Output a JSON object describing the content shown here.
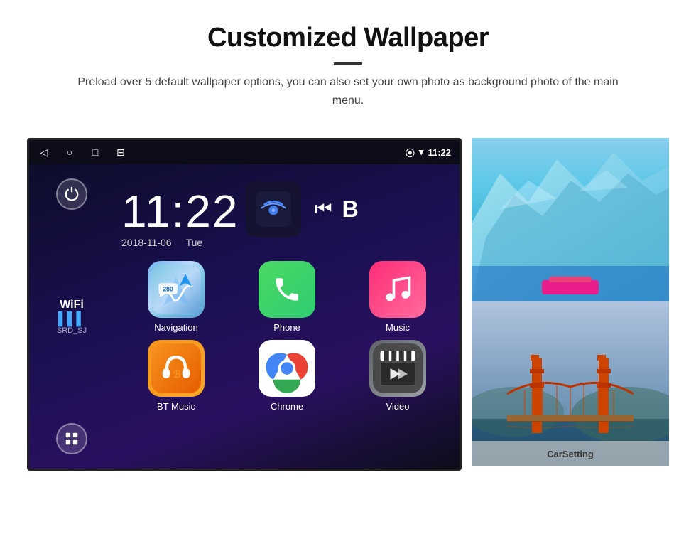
{
  "header": {
    "title": "Customized Wallpaper",
    "description": "Preload over 5 default wallpaper options, you can also set your own photo as background photo of the main menu."
  },
  "statusBar": {
    "time": "11:22",
    "navIcons": [
      "◁",
      "○",
      "□",
      "⊟"
    ],
    "rightIcons": [
      "location",
      "wifi",
      "signal"
    ]
  },
  "clock": {
    "time": "11:22",
    "date": "2018-11-06",
    "day": "Tue"
  },
  "wifi": {
    "label": "WiFi",
    "ssid": "SRD_SJ"
  },
  "apps": [
    {
      "name": "Navigation",
      "type": "nav"
    },
    {
      "name": "Phone",
      "type": "phone"
    },
    {
      "name": "Music",
      "type": "music"
    },
    {
      "name": "BT Music",
      "type": "bt"
    },
    {
      "name": "Chrome",
      "type": "chrome"
    },
    {
      "name": "Video",
      "type": "video"
    }
  ],
  "wallpapers": {
    "carsetting_label": "CarSetting"
  }
}
